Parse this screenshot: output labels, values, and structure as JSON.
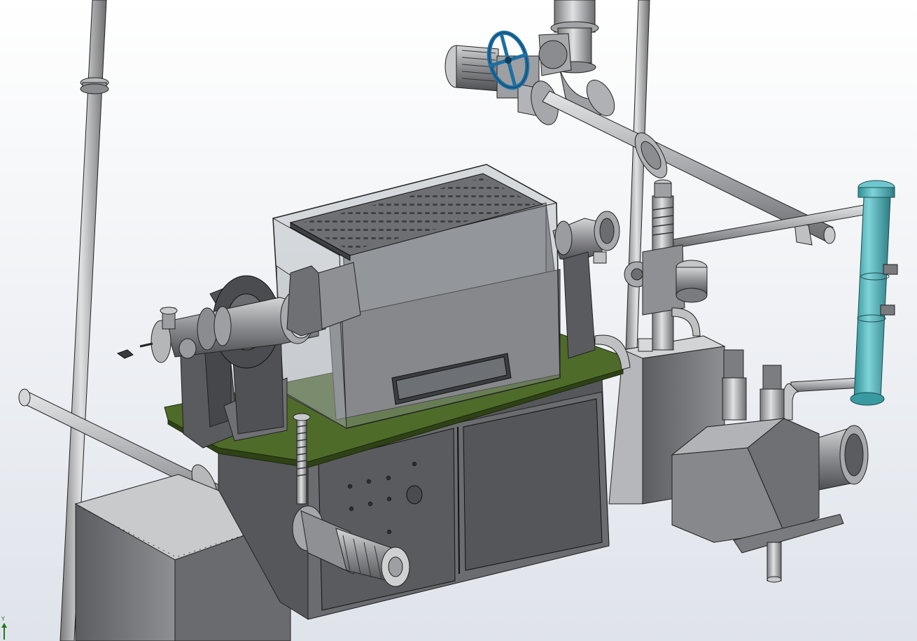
{
  "viewport": {
    "background_top": "#ffffff",
    "background_bottom": "#dfe3ea"
  },
  "colors": {
    "steel_light": "#c2c3c5",
    "steel_mid": "#8b8c8f",
    "steel_dark": "#4a4b4e",
    "base_green": "#4f6b2a",
    "handwheel_blue": "#1d6fa3",
    "heat_exchanger_cyan": "#4fb8bf",
    "glass_enclosure": "#9aa0a6",
    "edge_line": "#1a1a1a"
  },
  "triad": {
    "y_label": "Y",
    "axis_color": "#1f7a1f",
    "arrow_icon": "axis-arrow-icon"
  }
}
